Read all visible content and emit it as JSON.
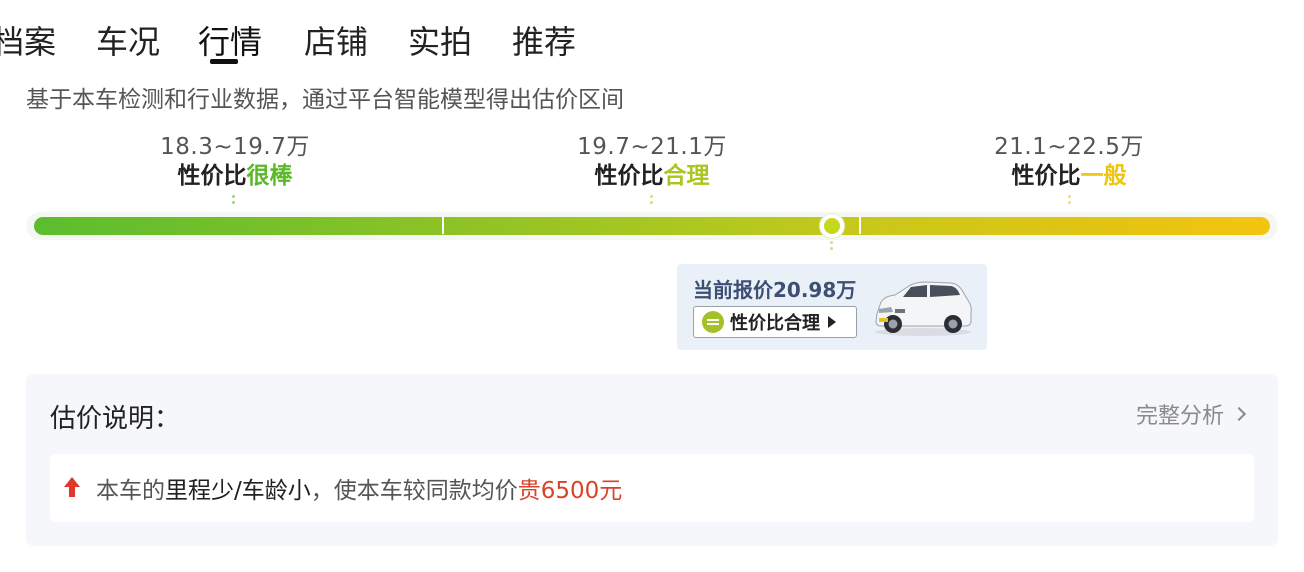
{
  "tabs": [
    {
      "label": "档案"
    },
    {
      "label": "车况"
    },
    {
      "label": "行情",
      "active": true
    },
    {
      "label": "店铺"
    },
    {
      "label": "实拍"
    },
    {
      "label": "推荐"
    }
  ],
  "subtitle": "基于本车检测和行业数据，通过平台智能模型得出估价区间",
  "ranges": [
    {
      "price": "18.3~19.7万",
      "prefix": "性价比",
      "level": "很棒",
      "color": "#5cb82a"
    },
    {
      "price": "19.7~21.1万",
      "prefix": "性价比",
      "level": "合理",
      "color": "#a8c61e"
    },
    {
      "price": "21.1~22.5万",
      "prefix": "性价比",
      "level": "一般",
      "color": "#eec40c"
    }
  ],
  "current": {
    "title": "当前报价20.98万",
    "badge_label": "性价比合理",
    "marker_position": 0.8
  },
  "icons": {
    "up": "arrow-up-icon",
    "badge": "equal-circle-icon",
    "chevron": "chevron-right-icon",
    "triangle": "triangle-right-icon"
  },
  "explanation": {
    "title": "估价说明：",
    "link_label": "完整分析",
    "note": {
      "part1": "本车的",
      "part2": "里程少/车龄小",
      "part3": "，使本车较同款均价",
      "part4": "贵6500元"
    }
  }
}
